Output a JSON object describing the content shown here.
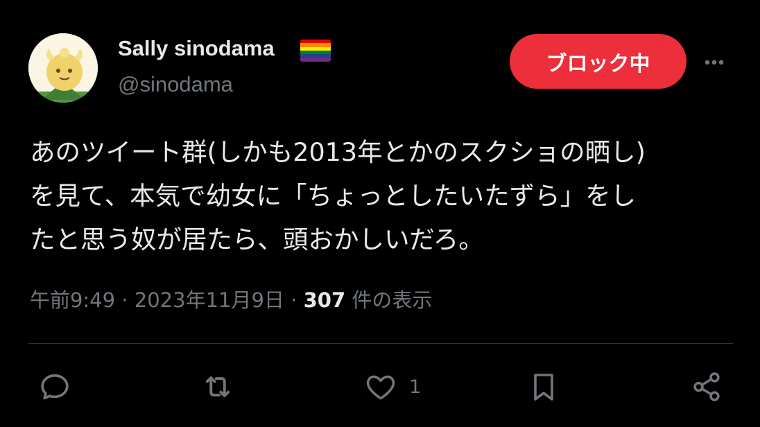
{
  "author": {
    "display_name": "Sally sinodama",
    "handle": "@sinodama",
    "avatar": "mascot-avatar",
    "flag_icon": "rainbow-flag-icon",
    "flag_colors": [
      "#e40303",
      "#ff8c00",
      "#ffed00",
      "#008026",
      "#24408e",
      "#732982"
    ]
  },
  "block_button": {
    "label": "ブロック中",
    "color": "#ec2f3b"
  },
  "more_icon": "more-horizontal-icon",
  "tweet": {
    "lines": [
      "あのツイート群(しかも2013年とかのスクショの晒し)",
      "を見て、本気で幼女に「ちょっとしたいたずら」をし",
      "たと思う奴が居たら、頭おかしいだろ。"
    ]
  },
  "meta": {
    "time": "午前9:49",
    "separator": "·",
    "date": "2023年11月9日",
    "views_count": "307",
    "views_label": "件の表示"
  },
  "actions": {
    "reply_icon": "reply-icon",
    "retweet_icon": "retweet-icon",
    "like_icon": "heart-icon",
    "like_count": "1",
    "bookmark_icon": "bookmark-icon",
    "share_icon": "share-icon"
  },
  "colors": {
    "background": "#000000",
    "primary_text": "#e7e9ea",
    "secondary_text": "#71767b",
    "divider": "#2f3336"
  }
}
